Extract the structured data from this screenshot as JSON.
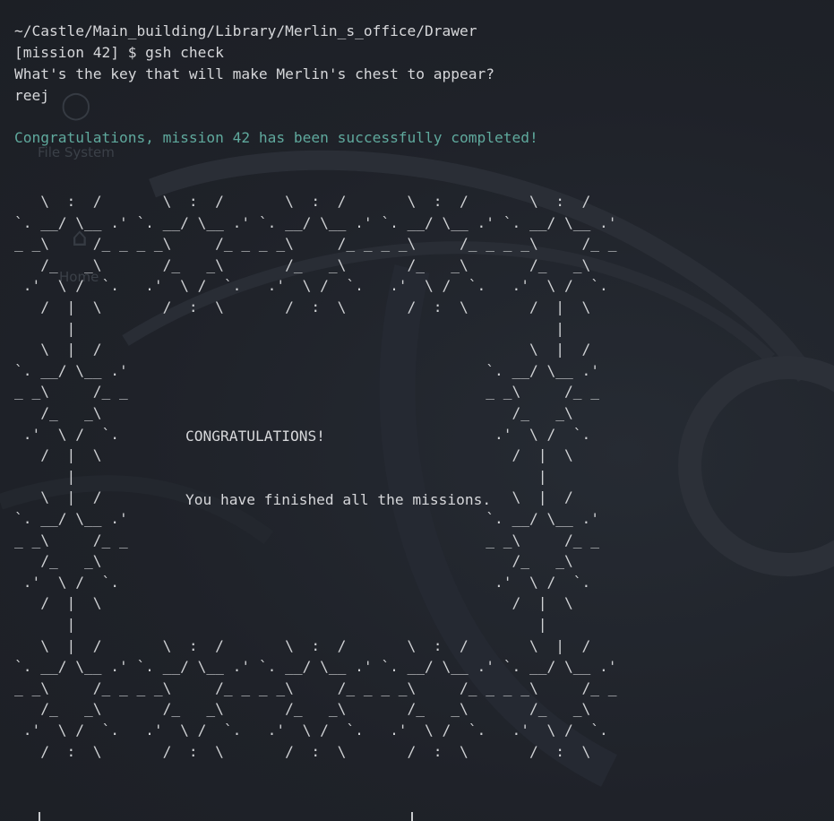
{
  "terminal": {
    "path": "~/Castle/Main_building/Library/Merlin_s_office/Drawer",
    "prompt": "[mission 42] $ gsh check",
    "question": "What's the key that will make Merlin's chest to appear?",
    "answer": "reej",
    "success": "Congratulations, mission 42 has been successfully completed!",
    "art": [
      "   \\  :  /       \\  :  /       \\  :  /       \\  :  /       \\  :  /",
      "`. __/ \\__ .' `. __/ \\__ .' `. __/ \\__ .' `. __/ \\__ .' `. __/ \\__ .'",
      "_ _\\     /_ _ _ _\\     /_ _ _ _\\     /_ _ _ _\\     /_ _ _ _\\     /_ _",
      "   /_   _\\       /_   _\\       /_   _\\       /_   _\\       /_   _\\",
      " .'  \\ /  `.   .'  \\ /  `.   .'  \\ /  `.   .'  \\ /  `.   .'  \\ /  `.",
      "   /  |  \\       /  :  \\       /  :  \\       /  :  \\       /  |  \\",
      "      |                                                       |",
      "   \\  |  /                                                 \\  |  /",
      "`. __/ \\__ .'                                         `. __/ \\__ .'",
      "_ _\\     /_ _                                         _ _\\     /_ _",
      "   /_   _\\                                               /_   _\\",
      " .'  \\ /  `.                                           .'  \\ /  `.",
      "   /  |  \\                                               /  |  \\",
      "      |                                                     |",
      "   \\  |  /                                               \\  |  /",
      "`. __/ \\__ .'                                         `. __/ \\__ .'",
      "_ _\\     /_ _                                         _ _\\     /_ _",
      "   /_   _\\                                               /_   _\\",
      " .'  \\ /  `.                                           .'  \\ /  `.",
      "   /  |  \\                                               /  |  \\",
      "      |                                                     |",
      "   \\  |  /       \\  :  /       \\  :  /       \\  :  /       \\  |  /",
      "`. __/ \\__ .' `. __/ \\__ .' `. __/ \\__ .' `. __/ \\__ .' `. __/ \\__ .'",
      "_ _\\     /_ _ _ _\\     /_ _ _ _\\     /_ _ _ _\\     /_ _ _ _\\     /_ _",
      "   /_   _\\       /_   _\\       /_   _\\       /_   _\\       /_   _\\",
      " .'  \\ /  `.   .'  \\ /  `.   .'  \\ /  `.   .'  \\ /  `.   .'  \\ /  `.",
      "   /  :  \\       /  :  \\       /  :  \\       /  :  \\       /  :  \\"
    ],
    "congrats": "CONGRATULATIONS!",
    "finished": "You have finished all the missions."
  },
  "desktop": {
    "icons": [
      {
        "name": "File System",
        "glyph": "◯"
      },
      {
        "name": "Home",
        "glyph": "⌂"
      }
    ]
  },
  "colors": {
    "background": "#1f2229",
    "text": "#d6d7da",
    "success": "#5fa99d"
  }
}
